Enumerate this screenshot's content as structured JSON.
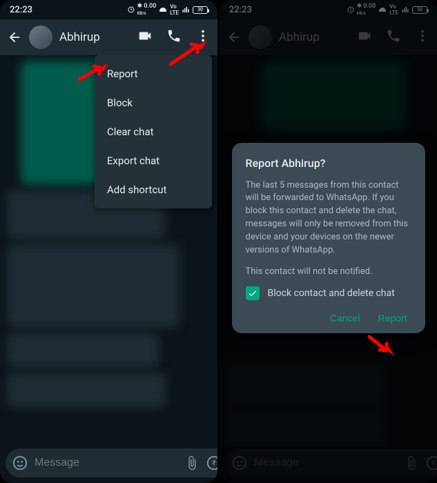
{
  "status": {
    "time": "22:23",
    "battery": "30"
  },
  "contact": {
    "name": "Abhirup"
  },
  "menu": {
    "items": [
      {
        "label": "Report"
      },
      {
        "label": "Block"
      },
      {
        "label": "Clear chat"
      },
      {
        "label": "Export chat"
      },
      {
        "label": "Add shortcut"
      }
    ]
  },
  "input": {
    "placeholder": "Message"
  },
  "dialog": {
    "title": "Report Abhirup?",
    "body1": "The last 5 messages from this contact will be forwarded to WhatsApp. If you block this contact and delete the chat, messages will only be removed from this device and your devices on the newer versions of WhatsApp.",
    "body2": "This contact will not be notified.",
    "checkbox_label": "Block contact and delete chat",
    "cancel": "Cancel",
    "confirm": "Report"
  }
}
